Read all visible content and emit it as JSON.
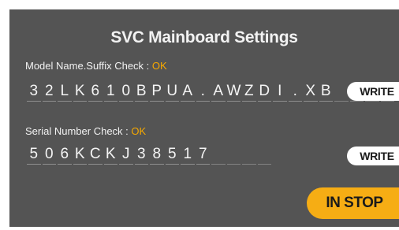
{
  "screen": {
    "title": "SVC Mainboard Settings"
  },
  "model": {
    "label": "Model Name.Suffix Check : ",
    "status": "OK",
    "chars": [
      "3",
      "2",
      "L",
      "K",
      "6",
      "1",
      "0",
      "B",
      "P",
      "U",
      "A",
      ".",
      "A",
      "W",
      "Z",
      "D",
      "I",
      ".",
      "X",
      "B",
      "",
      "",
      "",
      ""
    ],
    "write_label": "WRITE"
  },
  "serial": {
    "label": "Serial Number Check : ",
    "status": "OK",
    "chars": [
      "5",
      "0",
      "6",
      "K",
      "C",
      "K",
      "J",
      "3",
      "8",
      "5",
      "1",
      "7",
      "",
      "",
      "",
      ""
    ],
    "write_label": "WRITE"
  },
  "stop_button": {
    "label": "IN STOP"
  },
  "colors": {
    "panel": "#545454",
    "ok": "#f6a800",
    "stop": "#f6ad14"
  }
}
